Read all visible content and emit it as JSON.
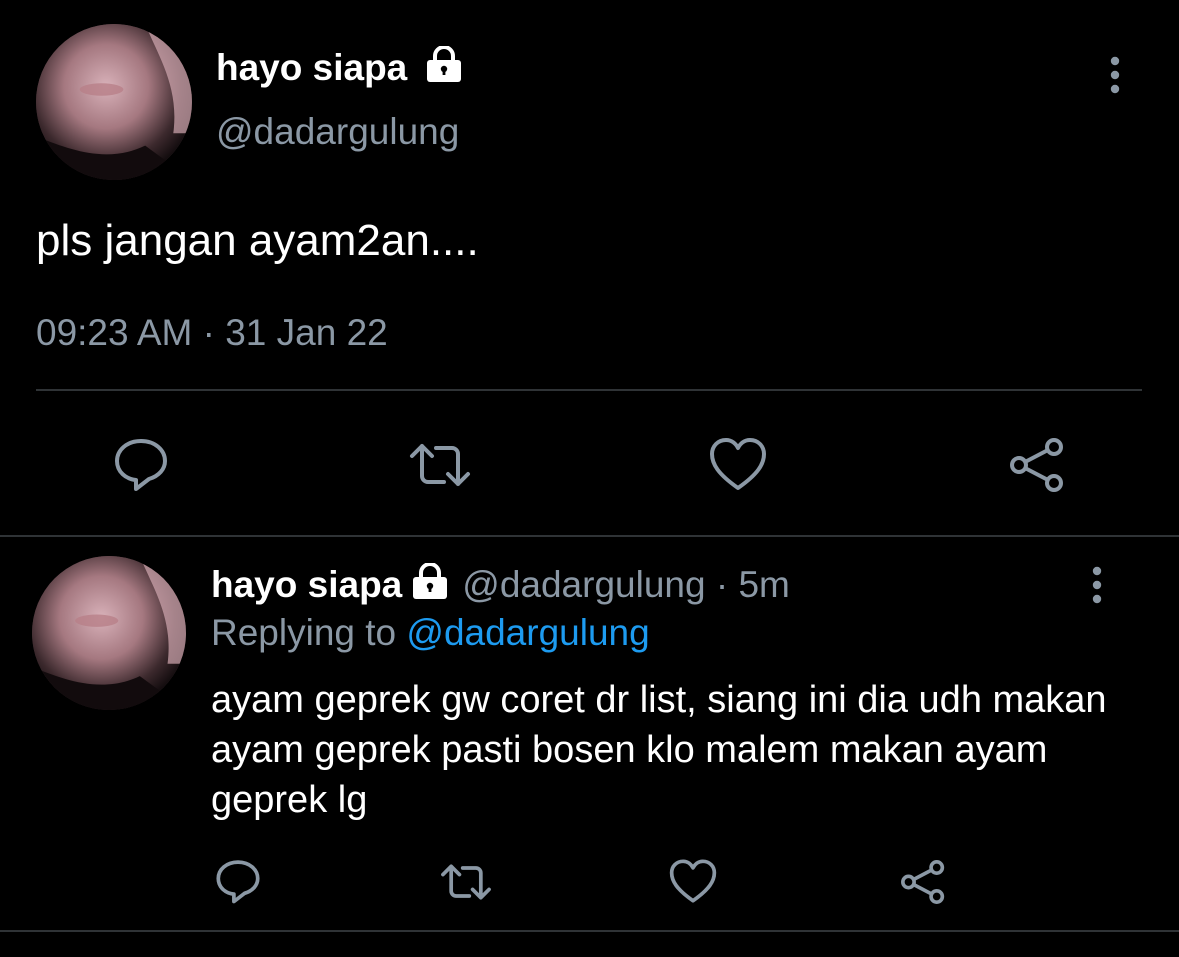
{
  "main_tweet": {
    "author_name": "hayo siapa",
    "handle": "@dadargulung",
    "text": "pls jangan ayam2an....",
    "timestamp": "09:23 AM · 31 Jan 22"
  },
  "reply_tweet": {
    "author_name": "hayo siapa",
    "handle": "@dadargulung",
    "time_ago": "· 5m",
    "replying_prefix": "Replying to",
    "replying_handle": "@dadargulung",
    "text": "ayam geprek gw coret dr list, siang ini dia udh makan ayam geprek pasti bosen klo malem makan ayam geprek lg"
  },
  "icons": {
    "lock": "lock-icon",
    "more": "more-vertical-icon",
    "reply": "reply-icon",
    "retweet": "retweet-icon",
    "like": "heart-icon",
    "share": "share-icon"
  },
  "colors": {
    "background": "#000000",
    "text": "#ffffff",
    "muted": "#8b98a5",
    "link": "#1d9bf0",
    "divider": "#2f3336"
  }
}
